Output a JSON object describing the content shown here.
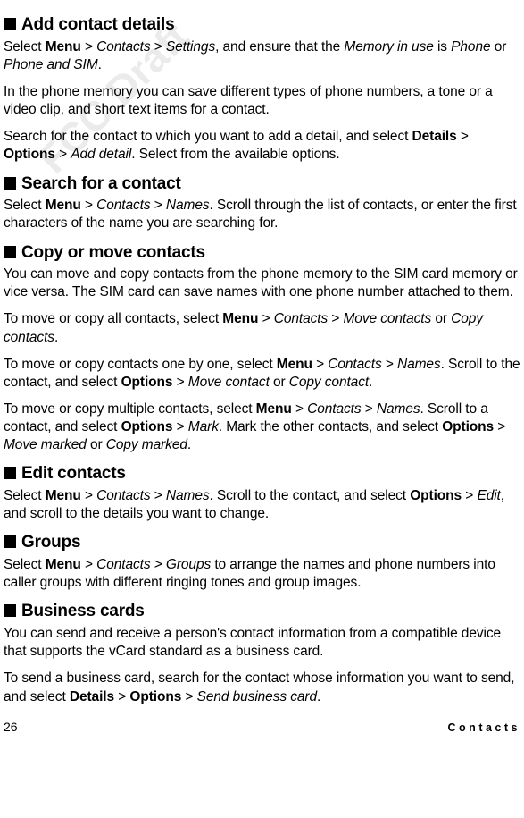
{
  "watermark": "FCC Draft",
  "sections": {
    "addContactDetails": {
      "title": "Add contact details",
      "p1a": "Select ",
      "p1b": "Menu",
      "p1c": " > ",
      "p1d": "Contacts",
      "p1e": " > ",
      "p1f": "Settings",
      "p1g": ", and ensure that the ",
      "p1h": "Memory in use",
      "p1i": " is ",
      "p1j": "Phone",
      "p1k": " or ",
      "p1l": "Phone and SIM",
      "p1m": ".",
      "p2": "In the phone memory you can save different types of phone numbers, a tone or a video clip, and short text items for a contact.",
      "p3a": "Search for the contact to which you want to add a detail, and select ",
      "p3b": "Details",
      "p3c": " > ",
      "p3d": "Options",
      "p3e": " > ",
      "p3f": "Add detail",
      "p3g": ". Select from the available options."
    },
    "searchContact": {
      "title": "Search for a contact",
      "p1a": "Select ",
      "p1b": "Menu",
      "p1c": " > ",
      "p1d": "Contacts",
      "p1e": " > ",
      "p1f": "Names",
      "p1g": ". Scroll through the list of contacts, or enter the first characters of the name you are searching for."
    },
    "copyMove": {
      "title": "Copy or move contacts",
      "p1": "You can move and copy contacts from the phone memory to the SIM card memory or vice versa. The SIM card can save names with one phone number attached to them.",
      "p2a": "To move or copy all contacts, select ",
      "p2b": "Menu",
      "p2c": " > ",
      "p2d": "Contacts",
      "p2e": " > ",
      "p2f": "Move contacts",
      "p2g": " or ",
      "p2h": "Copy contacts",
      "p2i": ".",
      "p3a": "To move or copy contacts one by one, select ",
      "p3b": "Menu",
      "p3c": " > ",
      "p3d": "Contacts",
      "p3e": " > ",
      "p3f": "Names",
      "p3g": ". Scroll to the contact, and select ",
      "p3h": "Options",
      "p3i": " > ",
      "p3j": "Move contact",
      "p3k": " or ",
      "p3l": "Copy contact",
      "p3m": ".",
      "p4a": "To move or copy multiple contacts, select ",
      "p4b": "Menu",
      "p4c": " > ",
      "p4d": "Contacts",
      "p4e": " > ",
      "p4f": "Names",
      "p4g": ". Scroll to a contact, and select ",
      "p4h": "Options",
      "p4i": " > ",
      "p4j": "Mark",
      "p4k": ". Mark the other contacts, and select ",
      "p4l": "Options",
      "p4m": " > ",
      "p4n": "Move marked",
      "p4o": " or ",
      "p4p": "Copy marked",
      "p4q": "."
    },
    "editContacts": {
      "title": "Edit contacts",
      "p1a": "Select ",
      "p1b": "Menu",
      "p1c": " > ",
      "p1d": "Contacts",
      "p1e": " > ",
      "p1f": "Names",
      "p1g": ". Scroll to the contact, and select ",
      "p1h": "Options",
      "p1i": " > ",
      "p1j": "Edit",
      "p1k": ", and scroll to the details you want to change."
    },
    "groups": {
      "title": "Groups",
      "p1a": "Select ",
      "p1b": "Menu",
      "p1c": " > ",
      "p1d": "Contacts",
      "p1e": " > ",
      "p1f": "Groups",
      "p1g": " to arrange the names and phone numbers into caller groups with different ringing tones and group images."
    },
    "businessCards": {
      "title": "Business cards",
      "p1": "You can send and receive a person's contact information from a compatible device that supports the vCard standard as a business card.",
      "p2a": "To send a business card, search for the contact whose information you want to send, and select ",
      "p2b": "Details",
      "p2c": " > ",
      "p2d": "Options",
      "p2e": " > ",
      "p2f": "Send business card",
      "p2g": "."
    }
  },
  "footer": {
    "pageNumber": "26",
    "sectionName": "Contacts"
  }
}
